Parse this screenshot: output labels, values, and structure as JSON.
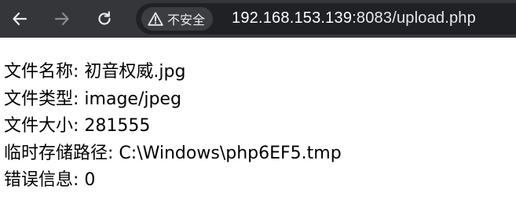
{
  "browser": {
    "back_icon": "arrow-left-icon",
    "forward_icon": "arrow-right-icon",
    "reload_icon": "reload-icon",
    "security_icon": "warning-triangle-icon",
    "security_label": "不安全",
    "url_host": "192.168.153.139",
    "url_path": ":8083/upload.php"
  },
  "upload_info": [
    {
      "label": "文件名称",
      "value": "初音权威.jpg"
    },
    {
      "label": "文件类型",
      "value": "image/jpeg"
    },
    {
      "label": "文件大小",
      "value": "281555"
    },
    {
      "label": "临时存储路径",
      "value": "C:\\Windows\\php6EF5.tmp"
    },
    {
      "label": "错误信息",
      "value": "0"
    }
  ],
  "separator": ": "
}
